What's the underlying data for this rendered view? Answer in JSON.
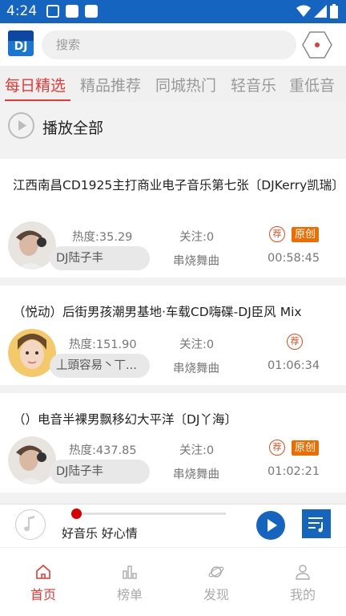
{
  "status_bar": {
    "time": "4:24"
  },
  "header": {
    "logo_text": "DJ",
    "search_placeholder": "搜索"
  },
  "tabs": [
    {
      "label": "每日精选",
      "active": true
    },
    {
      "label": "精品推荐",
      "active": false
    },
    {
      "label": "同城热门",
      "active": false
    },
    {
      "label": "轻音乐",
      "active": false
    },
    {
      "label": "重低音",
      "active": false
    }
  ],
  "play_all": {
    "label": "播放全部"
  },
  "tracks": [
    {
      "title": "江西南昌CD1925主打商业电子音乐第七张〔DJKerry凯瑞〕",
      "heat": "热度:35.29",
      "follow": "关注:0",
      "artist": "DJ陆子丰",
      "genre": "串烧舞曲",
      "duration": "00:58:45",
      "rec_badge": "荐",
      "orig_badge": "原创"
    },
    {
      "title": "（悦动）后街男孩潮男基地·车载CD嗨碟-DJ臣风 Mix",
      "heat": "热度:151.90",
      "follow": "关注:0",
      "artist": "丄頭容易丶丅...",
      "genre": "串烧舞曲",
      "duration": "01:06:34",
      "rec_badge": "荐"
    },
    {
      "title": "（）电音半裸男飘移幻大平洋〔DJ丫海〕",
      "heat": "热度:437.85",
      "follow": "关注:0",
      "artist": "DJ陆子丰",
      "genre": "串烧舞曲",
      "duration": "01:02:21",
      "rec_badge": "荐",
      "orig_badge": "原创"
    }
  ],
  "player": {
    "caption": "好音乐 好心情"
  },
  "bottom_nav": [
    {
      "label": "首页",
      "icon": "home-icon",
      "active": true
    },
    {
      "label": "榜单",
      "icon": "chart-icon",
      "active": false
    },
    {
      "label": "发现",
      "icon": "planet-icon",
      "active": false
    },
    {
      "label": "我的",
      "icon": "user-icon",
      "active": false
    }
  ],
  "colors": {
    "primary": "#1565c0",
    "accent": "#e53935",
    "badge_orange": "#ef6c00"
  }
}
